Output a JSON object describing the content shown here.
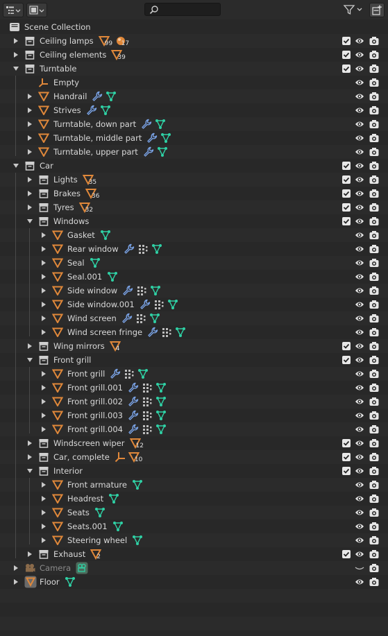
{
  "header": {
    "search_placeholder": "",
    "display_mode_icon": "outliner-view-icon",
    "filter_mode_icon": "filter-mode-icon",
    "filter_icon": "funnel-icon",
    "new_collection_icon": "new-collection-icon"
  },
  "colors": {
    "mesh_orange": "#e0883a",
    "wrench_blue": "#7aa3e6",
    "vertex_green": "#2fd1a5",
    "collection_white": "#cfcfcf"
  },
  "rows": [
    {
      "label": "Scene Collection",
      "depth": 0,
      "type": "scene",
      "arrow": "none",
      "vis": "none"
    },
    {
      "label": "Ceiling lamps",
      "depth": 1,
      "type": "collection",
      "arrow": "right",
      "vis": "check",
      "children": [
        {
          "icon": "mesh",
          "count": "99"
        },
        {
          "icon": "material",
          "count": "17"
        }
      ]
    },
    {
      "label": "Ceiling elements",
      "depth": 1,
      "type": "collection",
      "arrow": "right",
      "vis": "check",
      "children": [
        {
          "icon": "mesh",
          "count": "39"
        }
      ]
    },
    {
      "label": "Turntable",
      "depth": 1,
      "type": "collection",
      "arrow": "down",
      "vis": "check",
      "children": []
    },
    {
      "label": "Empty",
      "depth": 2,
      "type": "empty",
      "arrow": "none",
      "vis": "eye",
      "children": []
    },
    {
      "label": "Handrail",
      "depth": 2,
      "type": "mesh",
      "arrow": "right",
      "vis": "eye",
      "children": [
        {
          "icon": "wrench"
        },
        {
          "icon": "vertex"
        }
      ]
    },
    {
      "label": "Strives",
      "depth": 2,
      "type": "mesh",
      "arrow": "right",
      "vis": "eye",
      "children": [
        {
          "icon": "wrench"
        },
        {
          "icon": "vertex"
        }
      ]
    },
    {
      "label": "Turntable, down part",
      "depth": 2,
      "type": "mesh",
      "arrow": "right",
      "vis": "eye",
      "children": [
        {
          "icon": "wrench"
        },
        {
          "icon": "vertex"
        }
      ]
    },
    {
      "label": "Turntable, middle part",
      "depth": 2,
      "type": "mesh",
      "arrow": "right",
      "vis": "eye",
      "children": [
        {
          "icon": "wrench"
        },
        {
          "icon": "vertex"
        }
      ]
    },
    {
      "label": "Turntable, upper part",
      "depth": 2,
      "type": "mesh",
      "arrow": "right",
      "vis": "eye",
      "children": [
        {
          "icon": "wrench"
        },
        {
          "icon": "vertex"
        }
      ]
    },
    {
      "label": "Car",
      "depth": 1,
      "type": "collection",
      "arrow": "down",
      "vis": "check",
      "children": []
    },
    {
      "label": "Lights",
      "depth": 2,
      "type": "collection",
      "arrow": "right",
      "vis": "check",
      "children": [
        {
          "icon": "mesh",
          "count": "35"
        }
      ]
    },
    {
      "label": "Brakes",
      "depth": 2,
      "type": "collection",
      "arrow": "right",
      "vis": "check",
      "children": [
        {
          "icon": "mesh",
          "count": "36"
        }
      ]
    },
    {
      "label": "Tyres",
      "depth": 2,
      "type": "collection",
      "arrow": "right",
      "vis": "check",
      "children": [
        {
          "icon": "mesh",
          "count": "32"
        }
      ]
    },
    {
      "label": "Windows",
      "depth": 2,
      "type": "collection",
      "arrow": "down",
      "vis": "check",
      "children": []
    },
    {
      "label": "Gasket",
      "depth": 3,
      "type": "mesh",
      "arrow": "right",
      "vis": "eye",
      "children": [
        {
          "icon": "vertex"
        }
      ]
    },
    {
      "label": "Rear window",
      "depth": 3,
      "type": "mesh",
      "arrow": "right",
      "vis": "eye",
      "children": [
        {
          "icon": "wrench"
        },
        {
          "icon": "lattice"
        },
        {
          "icon": "vertex"
        }
      ]
    },
    {
      "label": "Seal",
      "depth": 3,
      "type": "mesh",
      "arrow": "right",
      "vis": "eye",
      "children": [
        {
          "icon": "vertex"
        }
      ]
    },
    {
      "label": "Seal.001",
      "depth": 3,
      "type": "mesh",
      "arrow": "right",
      "vis": "eye",
      "children": [
        {
          "icon": "vertex"
        }
      ]
    },
    {
      "label": "Side window",
      "depth": 3,
      "type": "mesh",
      "arrow": "right",
      "vis": "eye",
      "children": [
        {
          "icon": "wrench"
        },
        {
          "icon": "lattice"
        },
        {
          "icon": "vertex"
        }
      ]
    },
    {
      "label": "Side window.001",
      "depth": 3,
      "type": "mesh",
      "arrow": "right",
      "vis": "eye",
      "children": [
        {
          "icon": "wrench"
        },
        {
          "icon": "lattice"
        },
        {
          "icon": "vertex"
        }
      ]
    },
    {
      "label": "Wind screen",
      "depth": 3,
      "type": "mesh",
      "arrow": "right",
      "vis": "eye",
      "children": [
        {
          "icon": "wrench"
        },
        {
          "icon": "lattice"
        },
        {
          "icon": "vertex"
        }
      ]
    },
    {
      "label": "Wind screen fringe",
      "depth": 3,
      "type": "mesh",
      "arrow": "right",
      "vis": "eye",
      "children": [
        {
          "icon": "wrench"
        },
        {
          "icon": "lattice"
        },
        {
          "icon": "vertex"
        }
      ]
    },
    {
      "label": "Wing mirrors",
      "depth": 2,
      "type": "collection",
      "arrow": "right",
      "vis": "check",
      "children": [
        {
          "icon": "mesh",
          "count": "4"
        }
      ]
    },
    {
      "label": "Front grill",
      "depth": 2,
      "type": "collection",
      "arrow": "down",
      "vis": "check",
      "children": []
    },
    {
      "label": "Front grill",
      "depth": 3,
      "type": "mesh",
      "arrow": "right",
      "vis": "eye",
      "children": [
        {
          "icon": "wrench"
        },
        {
          "icon": "lattice"
        },
        {
          "icon": "vertex"
        }
      ]
    },
    {
      "label": "Front grill.001",
      "depth": 3,
      "type": "mesh",
      "arrow": "right",
      "vis": "eye",
      "children": [
        {
          "icon": "wrench"
        },
        {
          "icon": "lattice"
        },
        {
          "icon": "vertex"
        }
      ]
    },
    {
      "label": "Front grill.002",
      "depth": 3,
      "type": "mesh",
      "arrow": "right",
      "vis": "eye",
      "children": [
        {
          "icon": "wrench"
        },
        {
          "icon": "lattice"
        },
        {
          "icon": "vertex"
        }
      ]
    },
    {
      "label": "Front grill.003",
      "depth": 3,
      "type": "mesh",
      "arrow": "right",
      "vis": "eye",
      "children": [
        {
          "icon": "wrench"
        },
        {
          "icon": "lattice"
        },
        {
          "icon": "vertex"
        }
      ]
    },
    {
      "label": "Front grill.004",
      "depth": 3,
      "type": "mesh",
      "arrow": "right",
      "vis": "eye",
      "children": [
        {
          "icon": "wrench"
        },
        {
          "icon": "lattice"
        },
        {
          "icon": "vertex"
        }
      ]
    },
    {
      "label": "Windscreen wiper",
      "depth": 2,
      "type": "collection",
      "arrow": "right",
      "vis": "check",
      "children": [
        {
          "icon": "mesh",
          "count": "12"
        }
      ]
    },
    {
      "label": "Car, complete",
      "depth": 2,
      "type": "collection",
      "arrow": "right",
      "vis": "check",
      "children": [
        {
          "icon": "empty"
        },
        {
          "icon": "mesh",
          "count": "10"
        }
      ]
    },
    {
      "label": "Interior",
      "depth": 2,
      "type": "collection",
      "arrow": "down",
      "vis": "check",
      "children": []
    },
    {
      "label": "Front armature",
      "depth": 3,
      "type": "mesh",
      "arrow": "right",
      "vis": "eye",
      "children": [
        {
          "icon": "vertex"
        }
      ]
    },
    {
      "label": "Headrest",
      "depth": 3,
      "type": "mesh",
      "arrow": "right",
      "vis": "eye",
      "children": [
        {
          "icon": "vertex"
        }
      ]
    },
    {
      "label": "Seats",
      "depth": 3,
      "type": "mesh",
      "arrow": "right",
      "vis": "eye",
      "children": [
        {
          "icon": "vertex"
        }
      ]
    },
    {
      "label": "Seats.001",
      "depth": 3,
      "type": "mesh",
      "arrow": "right",
      "vis": "eye",
      "children": [
        {
          "icon": "vertex"
        }
      ]
    },
    {
      "label": "Steering wheel",
      "depth": 3,
      "type": "mesh",
      "arrow": "right",
      "vis": "eye",
      "children": [
        {
          "icon": "vertex"
        }
      ]
    },
    {
      "label": "Exhaust",
      "depth": 2,
      "type": "collection",
      "arrow": "right",
      "vis": "check",
      "children": [
        {
          "icon": "mesh",
          "count": "2"
        }
      ]
    },
    {
      "label": "Camera",
      "depth": 1,
      "type": "camera",
      "arrow": "right",
      "vis": "eye-hidden",
      "dim": true,
      "children": [
        {
          "icon": "camera-data"
        }
      ]
    },
    {
      "label": "Floor",
      "depth": 1,
      "type": "mesh-boxed",
      "arrow": "right",
      "vis": "eye",
      "children": [
        {
          "icon": "vertex"
        }
      ]
    }
  ]
}
